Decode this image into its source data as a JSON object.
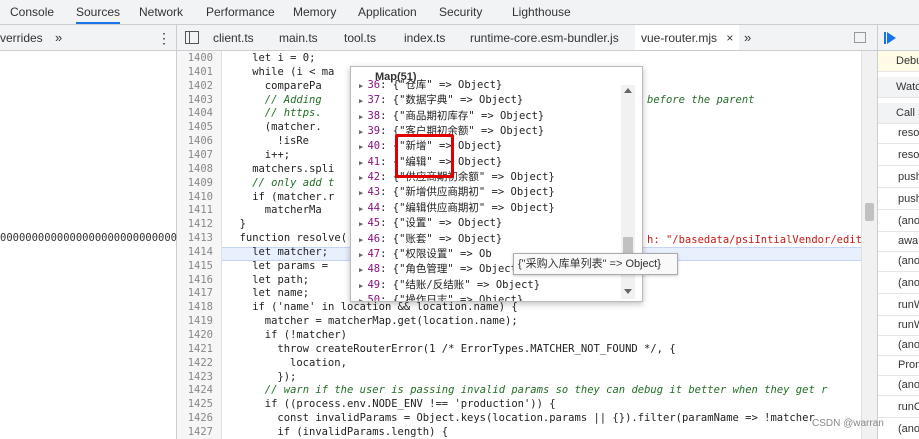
{
  "top_tabs": [
    "Console",
    "Sources",
    "Network",
    "Performance",
    "Memory",
    "Application",
    "Security",
    "Lighthouse"
  ],
  "active_top_tab": "Sources",
  "left_tab": "verrides",
  "left_more": "»",
  "left_menu": "⋮",
  "file_tabs": [
    "client.ts",
    "main.ts",
    "tool.ts",
    "index.ts",
    "runtime-core.esm-bundler.js",
    "vue-router.mjs"
  ],
  "file_tab_close": "×",
  "file_more": "»",
  "left_value": "000000000000000000000000000018",
  "code": [
    {
      "n": "1400",
      "t": "let i = 0;"
    },
    {
      "n": "1401",
      "t": "while (i < ma"
    },
    {
      "n": "1402",
      "t": "comparePa"
    },
    {
      "n": "1403",
      "t": "// Adding"
    },
    {
      "n": "1404",
      "t": "// https."
    },
    {
      "n": "1405",
      "t": "(matcher."
    },
    {
      "n": "1406",
      "t": "!isRe"
    },
    {
      "n": "1407",
      "t": "i++;"
    },
    {
      "n": "1408",
      "t": "matchers.spli"
    },
    {
      "n": "1409",
      "t": "// only add t"
    },
    {
      "n": "1410",
      "t": "if (matcher.r"
    },
    {
      "n": "1411",
      "t": "matcherMa"
    },
    {
      "n": "1412",
      "t": "}"
    },
    {
      "n": "1413",
      "t": "function resolve("
    },
    {
      "n": "1414",
      "t": "let matcher;"
    },
    {
      "n": "1415",
      "t": "let params = "
    },
    {
      "n": "1416",
      "t": "let path;"
    },
    {
      "n": "1417",
      "t": "let name;"
    },
    {
      "n": "1418",
      "t": "if ('name' in location && location.name) {"
    },
    {
      "n": "1419",
      "t": "matcher = matcherMap.get(location.name);"
    },
    {
      "n": "1420",
      "t": "if (!matcher)"
    },
    {
      "n": "1421",
      "t": "throw createRouterError(1 /* ErrorTypes.MATCHER_NOT_FOUND */, {"
    },
    {
      "n": "1422",
      "t": "location,"
    },
    {
      "n": "1423",
      "t": "});"
    },
    {
      "n": "1424",
      "t": "// warn if the user is passing invalid params so they can debug it better when they get r"
    },
    {
      "n": "1425",
      "t": "if ((process.env.NODE_ENV !== 'production')) {"
    },
    {
      "n": "1426",
      "t": "const invalidParams = Object.keys(location.params || {}).filter(paramName => !matcher"
    },
    {
      "n": "1427",
      "t": "if (invalidParams.length) {"
    }
  ],
  "code_right_fragments": {
    "line_1403": "before the parent",
    "line_1413": "h: \"/basedata/psiIntialVendor/edit"
  },
  "popup": {
    "title": "Map(51)",
    "items": [
      {
        "k": "36",
        "v": "{\"仓库\" => Object}"
      },
      {
        "k": "37",
        "v": "{\"数据字典\" => Object}"
      },
      {
        "k": "38",
        "v": "{\"商品期初库存\" => Object}"
      },
      {
        "k": "39",
        "v": "{\"客户期初余额\" => Object}"
      },
      {
        "k": "40",
        "v": "{\"新增\" => Object}"
      },
      {
        "k": "41",
        "v": "{\"编辑\" => Object}"
      },
      {
        "k": "42",
        "v": "{\"供应商期初余额\" => Object}"
      },
      {
        "k": "43",
        "v": "{\"新增供应商期初\" => Object}"
      },
      {
        "k": "44",
        "v": "{\"编辑供应商期初\" => Object}"
      },
      {
        "k": "45",
        "v": "{\"设置\" => Object}"
      },
      {
        "k": "46",
        "v": "{\"账套\" => Object}"
      },
      {
        "k": "47",
        "v": "{\"权限设置\" => Ob"
      },
      {
        "k": "48",
        "v": "{\"角色管理\" => Object}"
      },
      {
        "k": "49",
        "v": "{\"结账/反结账\" => Object}"
      },
      {
        "k": "50",
        "v": "{\"操作日志\" => Object}"
      }
    ]
  },
  "tooltip": "{\"采购入库单列表\" => Object}",
  "right_pane": {
    "items": [
      "Debu",
      "Watc",
      "Call S",
      "reso",
      "reso",
      "push",
      "push",
      "(ano",
      "awa",
      "(ano",
      "(ano",
      "runW",
      "runW",
      "(ano",
      "Pron",
      "(ano",
      "runC",
      "(ano"
    ]
  },
  "watermark": "CSDN @warran",
  "colors": {
    "accent": "#1a73e8",
    "highlight_box": "#e00000"
  }
}
